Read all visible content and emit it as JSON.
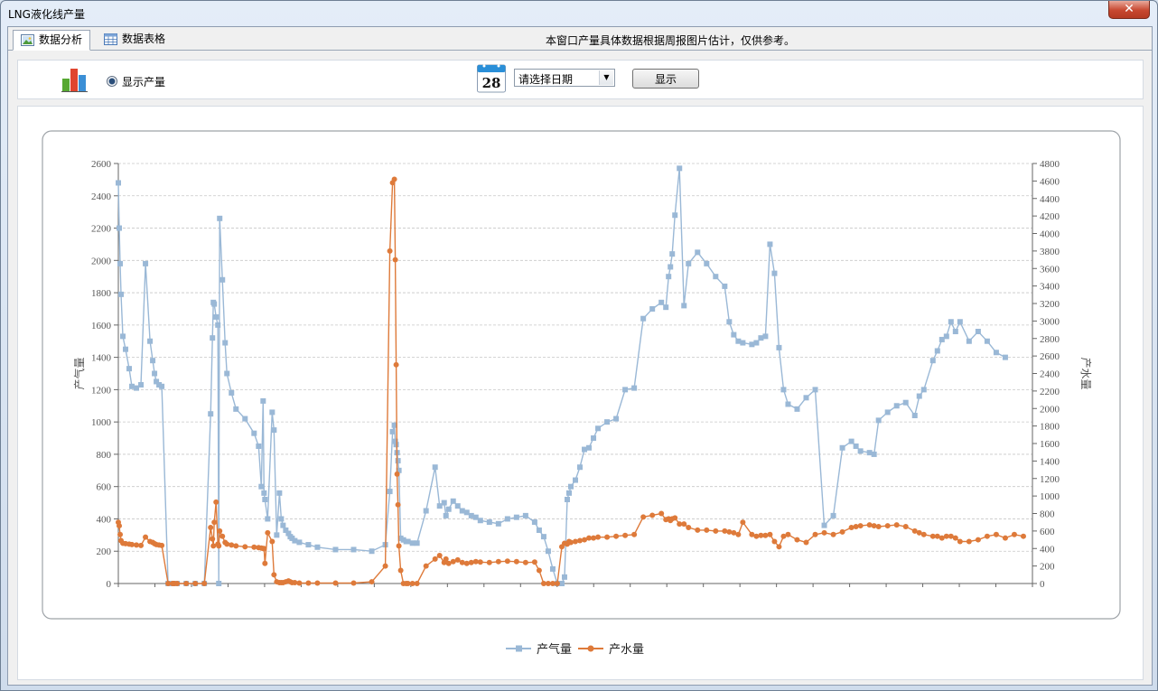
{
  "window": {
    "title": "LNG液化线产量",
    "close_label": "✕"
  },
  "tabs": [
    {
      "label": "数据分析",
      "icon": "chart-image-icon",
      "active": true
    },
    {
      "label": "数据表格",
      "icon": "table-grid-icon",
      "active": false
    }
  ],
  "notice": "本窗口产量具体数据根据周报图片估计，仅供参考。",
  "toolbar": {
    "radio_label": "显示产量",
    "radio_checked": true,
    "calendar_day": "28",
    "date_placeholder": "请选择日期",
    "show_label": "显示"
  },
  "colors": {
    "gas": "#9ab8d6",
    "water": "#de7a3a",
    "grid": "#c7c7c7",
    "axis_text": "#555555"
  },
  "chart_data": {
    "type": "line",
    "title": "",
    "xlabel": "",
    "ylabel": "产气量",
    "y2label": "产水量",
    "ylim": [
      0,
      2600
    ],
    "y2lim": [
      0,
      4800
    ],
    "yticks": [
      0,
      200,
      400,
      600,
      800,
      1000,
      1200,
      1400,
      1600,
      1800,
      2000,
      2200,
      2400,
      2600
    ],
    "y2ticks": [
      0,
      200,
      400,
      600,
      800,
      1000,
      1200,
      1400,
      1600,
      1800,
      2000,
      2200,
      2400,
      2600,
      2800,
      3000,
      3200,
      3400,
      3600,
      3800,
      4000,
      4200,
      4400,
      4600,
      4800
    ],
    "grid": true,
    "legend_position": "bottom-center",
    "x": [
      0,
      1,
      2,
      3,
      5,
      8,
      12,
      15,
      20,
      25,
      30,
      35,
      38,
      40,
      42,
      45,
      48,
      55,
      60,
      61,
      62,
      65,
      75,
      85,
      95,
      102,
      104,
      105,
      106,
      108,
      110,
      111,
      112,
      115,
      118,
      120,
      125,
      130,
      140,
      150,
      155,
      158,
      160,
      161,
      162,
      165,
      170,
      172,
      175,
      178,
      180,
      182,
      185,
      188,
      190,
      192,
      195,
      200,
      210,
      220,
      240,
      260,
      280,
      295,
      300,
      303,
      305,
      306,
      307,
      308,
      309,
      310,
      312,
      315,
      318,
      320,
      325,
      330,
      340,
      350,
      355,
      360,
      362,
      365,
      370,
      375,
      380,
      385,
      390,
      395,
      400,
      410,
      420,
      430,
      440,
      450,
      460,
      465,
      470,
      475,
      480,
      485,
      490,
      493,
      496,
      498,
      500,
      505,
      510,
      515,
      520,
      525,
      530,
      540,
      550,
      560,
      570,
      580,
      590,
      600,
      605,
      608,
      610,
      612,
      615,
      620,
      625,
      630,
      640,
      650,
      660,
      670,
      675,
      680,
      685,
      690,
      700,
      705,
      710,
      715,
      720,
      725,
      730,
      735,
      740,
      750,
      760,
      770,
      780,
      790,
      800,
      810,
      815,
      820,
      830,
      835,
      840,
      850,
      860,
      870,
      880,
      885,
      890,
      900,
      905,
      910,
      915,
      920,
      925,
      930,
      940,
      950,
      960,
      970,
      980,
      990,
      1000,
      1005,
      1010
    ],
    "series": [
      {
        "name": "产气量",
        "axis": "left",
        "marker": "square",
        "values": [
          2480,
          2200,
          1980,
          1790,
          1530,
          1450,
          1330,
          1220,
          1210,
          1230,
          1980,
          1500,
          1380,
          1300,
          1250,
          1230,
          1220,
          0,
          0,
          0,
          0,
          0,
          0,
          0,
          0,
          1050,
          1520,
          1740,
          1730,
          1650,
          1600,
          0,
          2260,
          1880,
          1490,
          1300,
          1180,
          1080,
          1020,
          930,
          850,
          600,
          1130,
          560,
          520,
          400,
          1060,
          950,
          300,
          560,
          400,
          360,
          330,
          310,
          290,
          280,
          265,
          255,
          240,
          225,
          210,
          210,
          200,
          240,
          570,
          940,
          980,
          880,
          860,
          810,
          760,
          700,
          280,
          270,
          260,
          260,
          250,
          250,
          450,
          720,
          480,
          500,
          420,
          460,
          510,
          480,
          450,
          440,
          420,
          410,
          390,
          380,
          370,
          400,
          410,
          420,
          380,
          330,
          290,
          200,
          90,
          0,
          0,
          40,
          520,
          560,
          600,
          640,
          720,
          830,
          840,
          900,
          960,
          1000,
          1020,
          1200,
          1210,
          1640,
          1700,
          1740,
          1710,
          1900,
          1960,
          2040,
          2280,
          2570,
          1720,
          1980,
          2050,
          1980,
          1900,
          1840,
          1620,
          1540,
          1500,
          1490,
          1480,
          1490,
          1520,
          1530,
          2100,
          1920,
          1460,
          1200,
          1110,
          1080,
          1150,
          1200,
          360,
          420,
          840,
          880,
          850,
          820,
          810,
          800,
          1010,
          1060,
          1100,
          1120,
          1040,
          1160,
          1200,
          1380,
          1440,
          1510,
          1530,
          1620,
          1560,
          1620,
          1500,
          1560,
          1500,
          1430,
          1400
        ]
      },
      {
        "name": "产水量",
        "axis": "right",
        "marker": "circle",
        "values": [
          700,
          660,
          560,
          490,
          460,
          455,
          450,
          445,
          440,
          435,
          530,
          480,
          470,
          455,
          445,
          440,
          435,
          0,
          0,
          0,
          0,
          0,
          0,
          0,
          0,
          640,
          510,
          430,
          700,
          930,
          450,
          430,
          600,
          540,
          470,
          450,
          440,
          430,
          420,
          415,
          410,
          405,
          400,
          400,
          230,
          580,
          480,
          100,
          20,
          10,
          10,
          10,
          20,
          30,
          20,
          10,
          10,
          5,
          5,
          5,
          5,
          5,
          20,
          200,
          3800,
          4580,
          4620,
          3700,
          2500,
          1250,
          900,
          430,
          150,
          0,
          0,
          0,
          0,
          0,
          200,
          280,
          320,
          240,
          280,
          230,
          250,
          270,
          240,
          230,
          240,
          250,
          245,
          240,
          250,
          255,
          250,
          240,
          245,
          150,
          0,
          0,
          0,
          0,
          420,
          460,
          450,
          480,
          470,
          480,
          490,
          500,
          520,
          520,
          530,
          530,
          540,
          550,
          560,
          760,
          780,
          800,
          730,
          740,
          720,
          740,
          750,
          680,
          680,
          640,
          610,
          610,
          600,
          600,
          590,
          580,
          560,
          700,
          560,
          540,
          550,
          550,
          560,
          480,
          420,
          540,
          560,
          500,
          470,
          560,
          580,
          560,
          590,
          640,
          650,
          660,
          670,
          660,
          650,
          660,
          670,
          650,
          600,
          580,
          560,
          540,
          540,
          520,
          540,
          540,
          520,
          480,
          480,
          500,
          540,
          560,
          520,
          560,
          540
        ]
      }
    ]
  }
}
